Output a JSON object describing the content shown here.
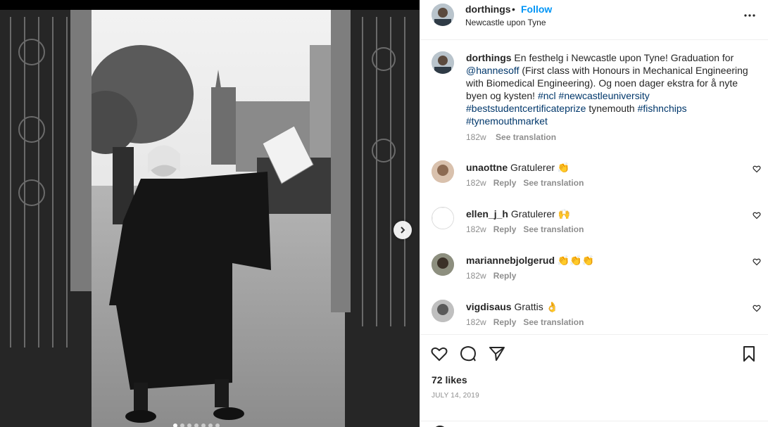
{
  "post": {
    "username": "dorthings",
    "separator": "•",
    "follow_label": "Follow",
    "location": "Newcastle upon Tyne",
    "caption": {
      "username": "dorthings",
      "segments": [
        {
          "text": " En festhelg i Newcastle upon Tyne! Graduation for ",
          "tag": false
        },
        {
          "text": "@hannesoff",
          "tag": true
        },
        {
          "text": " (First class with Honours in Mechanical Engineering with Biomedical Engineering). Og noen dager ekstra for å nyte byen og kysten! ",
          "tag": false
        },
        {
          "text": "#ncl",
          "tag": true
        },
        {
          "text": " ",
          "tag": false
        },
        {
          "text": "#newcastleuniversity",
          "tag": true
        },
        {
          "text": " ",
          "tag": false
        },
        {
          "text": "#beststudentcertificateprize",
          "tag": true
        },
        {
          "text": " tynemouth ",
          "tag": false
        },
        {
          "text": "#fishnchips",
          "tag": true
        },
        {
          "text": " ",
          "tag": false
        },
        {
          "text": "#tynemouthmarket",
          "tag": true
        }
      ],
      "time": "182w",
      "see_translation": "See translation"
    },
    "comments": [
      {
        "user": "unaottne",
        "text": "Gratulerer",
        "emoji": "👏",
        "time": "182w",
        "reply": "Reply",
        "see_translation": "See translation"
      },
      {
        "user": "ellen_j_h",
        "text": "Gratulerer",
        "emoji": "🙌",
        "time": "182w",
        "reply": "Reply",
        "see_translation": "See translation"
      },
      {
        "user": "mariannebjolgerud",
        "text": "",
        "emoji": "👏👏👏",
        "time": "182w",
        "reply": "Reply",
        "see_translation": ""
      },
      {
        "user": "vigdisaus",
        "text": "Grattis",
        "emoji": "👌",
        "time": "182w",
        "reply": "Reply",
        "see_translation": "See translation"
      }
    ],
    "likes": "72 likes",
    "date": "JULY 14, 2019",
    "carousel": {
      "total": 7,
      "active": 0
    }
  },
  "icons": {
    "more": "more-options-icon",
    "like": "heart-icon",
    "comment": "comment-icon",
    "share": "share-icon",
    "save": "bookmark-icon",
    "next": "chevron-right-icon",
    "emoji": "emoji-icon"
  },
  "colors": {
    "follow": "#0095f6",
    "tag": "#00376b",
    "muted": "#8e8e8e",
    "text": "#262626"
  }
}
